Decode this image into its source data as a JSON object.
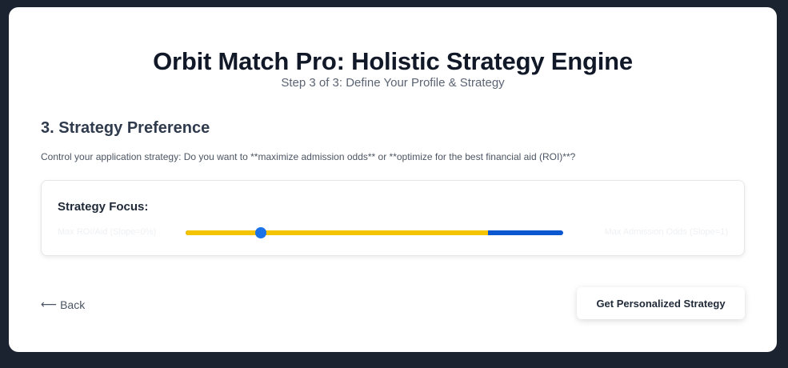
{
  "header": {
    "title": "Orbit Match Pro: Holistic Strategy Engine",
    "step": "Step 3 of 3: Define Your Profile & Strategy"
  },
  "section": {
    "title": "3. Strategy Preference",
    "description": "Control your application strategy: Do you want to **maximize admission odds** or **optimize for the best financial aid (ROI)**?"
  },
  "strategy": {
    "label": "Strategy Focus:",
    "min_label": "Max ROI/Aid (Slope=0%)",
    "max_label": "Max Admission Odds (Slope=1)",
    "value_fraction": 0.2,
    "colors": {
      "track_fill": "#f5c400",
      "track_rest": "#0b57d0",
      "thumb": "#1a73e8"
    }
  },
  "nav": {
    "back_arrow": "⟵",
    "back_label": "Back",
    "submit_label": "Get Personalized Strategy"
  }
}
